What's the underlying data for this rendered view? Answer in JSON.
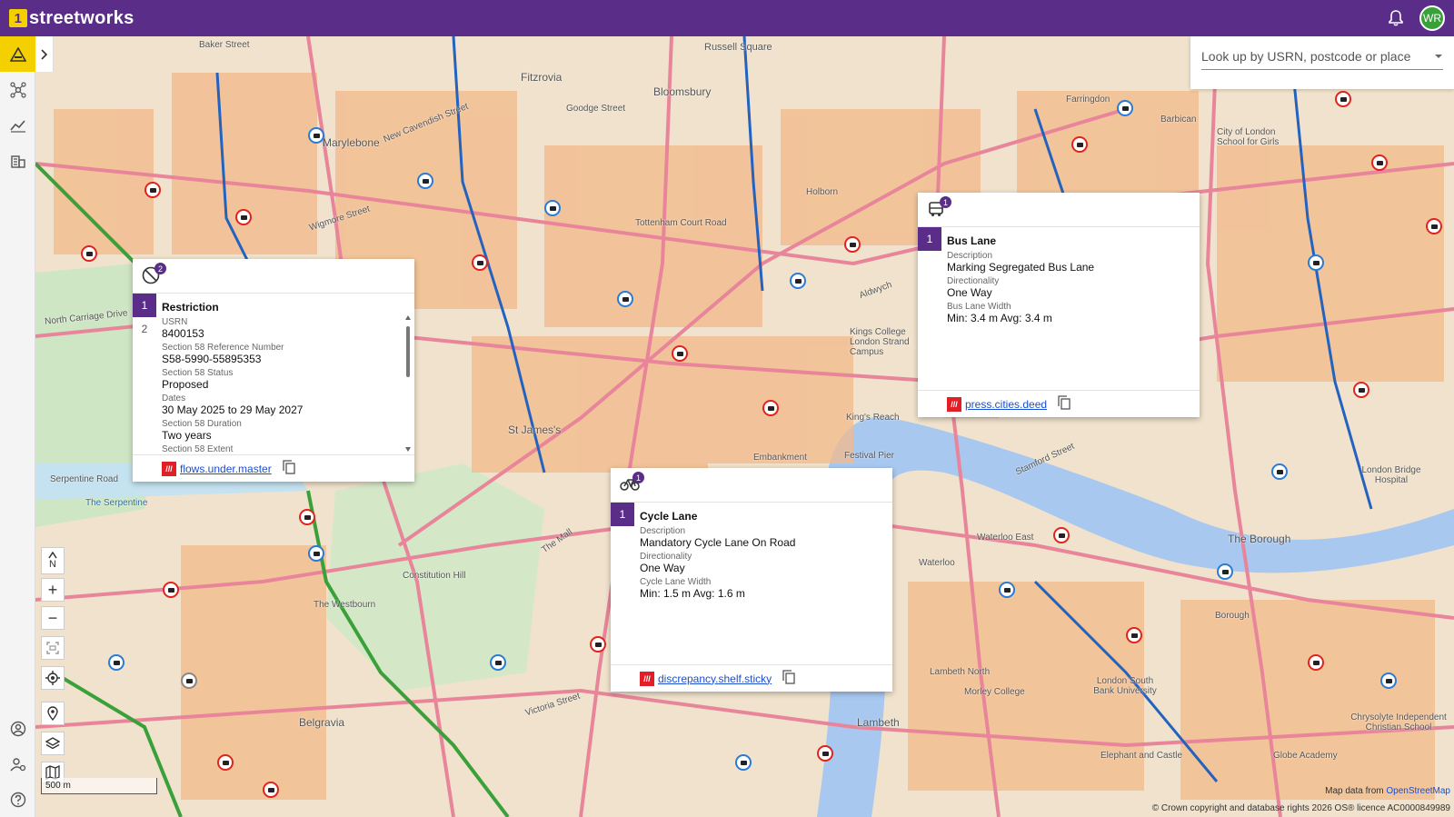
{
  "app": {
    "logo_mark": "1",
    "name": "streetworks",
    "user_initials": "WR"
  },
  "search": {
    "placeholder": "Look up by USRN, postcode or place"
  },
  "popups": {
    "restriction": {
      "count": "2",
      "tabs": [
        "1",
        "2"
      ],
      "title": "Restriction",
      "fields": [
        {
          "label": "USRN",
          "value": "8400153"
        },
        {
          "label": "Section 58 Reference Number",
          "value": "S58-5990-55895353"
        },
        {
          "label": "Section 58 Status",
          "value": "Proposed"
        },
        {
          "label": "Dates",
          "value": "30 May 2025 to 29 May 2027"
        },
        {
          "label": "Section 58 Duration",
          "value": "Two years"
        },
        {
          "label": "Section 58 Extent",
          "value": ""
        }
      ],
      "w3w": "flows.under.master"
    },
    "bus_lane": {
      "count": "1",
      "tabs": [
        "1"
      ],
      "title": "Bus Lane",
      "fields": [
        {
          "label": "Description",
          "value": "Marking Segregated Bus Lane"
        },
        {
          "label": "Directionality",
          "value": "One Way"
        },
        {
          "label": "Bus Lane Width",
          "value": "Min: 3.4 m Avg: 3.4 m"
        }
      ],
      "w3w": "press.cities.deed"
    },
    "cycle_lane": {
      "count": "1",
      "tabs": [
        "1"
      ],
      "title": "Cycle Lane",
      "fields": [
        {
          "label": "Description",
          "value": "Mandatory Cycle Lane On Road"
        },
        {
          "label": "Directionality",
          "value": "One Way"
        },
        {
          "label": "Cycle Lane Width",
          "value": "Min: 1.5 m Avg: 1.6 m"
        }
      ],
      "w3w": "discrepancy.shelf.sticky"
    }
  },
  "map": {
    "controls": {
      "north": "N",
      "zoom_in": "+",
      "zoom_out": "−"
    },
    "scale": "500 m",
    "attribution_top": "Map data from",
    "attribution_osm": "OpenStreetMap",
    "attribution_bottom": "© Crown copyright and database rights 2026 OS® licence AC0000849989",
    "labels": [
      "Baker Street",
      "Marylebone",
      "Fitzrovia",
      "Bloomsbury",
      "Russell Square",
      "Goodge Street",
      "Holborn",
      "Farringdon",
      "Barbican",
      "City of London School for Girls",
      "Tottenham Court Road",
      "Wigmore Street",
      "St James's",
      "Embankment",
      "Festival Pier",
      "King's Reach",
      "Waterloo East",
      "Waterloo",
      "The Borough",
      "Borough",
      "Lambeth North",
      "Lambeth",
      "Belgravia",
      "Victoria Street",
      "The Mall",
      "The Serpentine",
      "Serpentine Road",
      "North Carriage Drive",
      "Constitution Hill",
      "London Bridge Hospital",
      "Elephant and Castle",
      "Globe Academy",
      "London South Bank University",
      "Morley College",
      "Chrysolyte Independent Christian School",
      "Kings College London Strand Campus",
      "Aldwych",
      "Stamford Street",
      "New Cavendish Street",
      "The Westbourn"
    ]
  },
  "colors": {
    "brand": "#5a2d88",
    "accent": "#f5d000",
    "avatar": "#3aa13a",
    "w3w": "#e11f26"
  }
}
